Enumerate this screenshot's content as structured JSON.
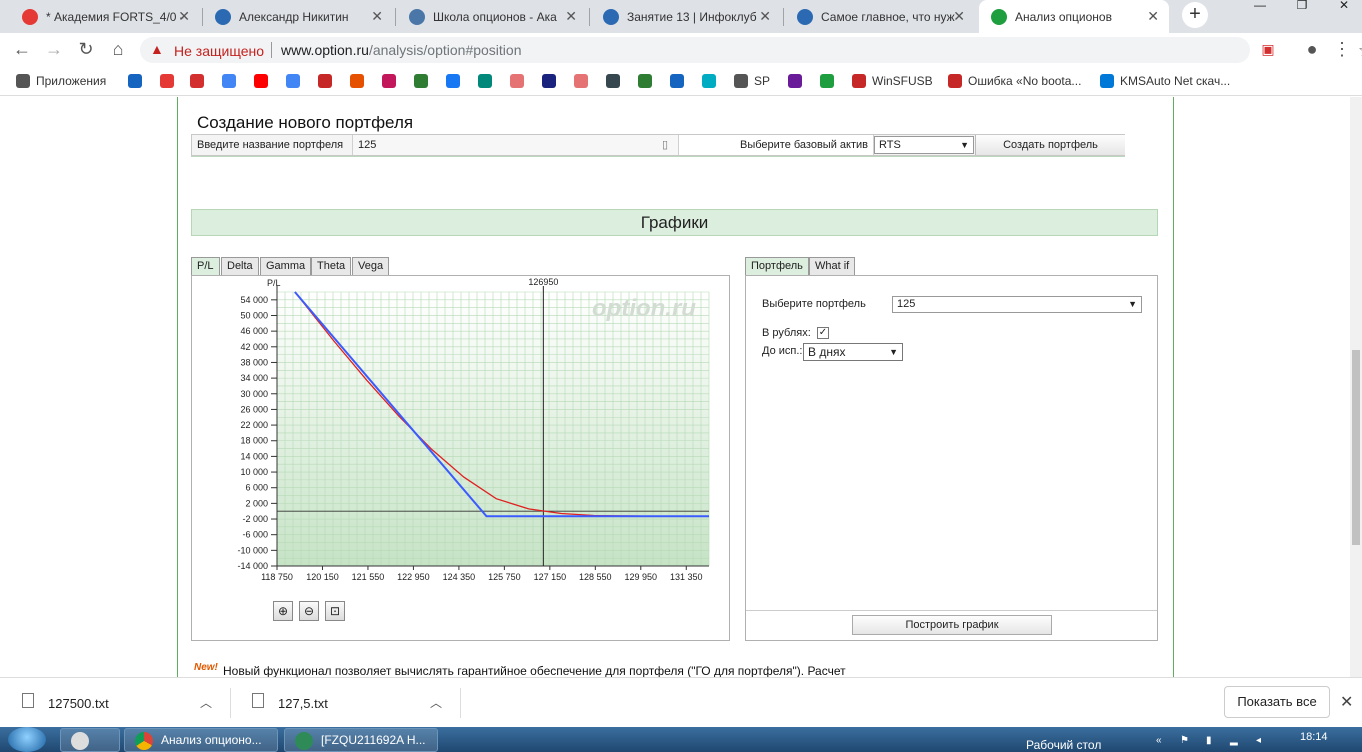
{
  "browser": {
    "tabs": [
      {
        "label": "* Академия FORTS_4/0 -",
        "active": false,
        "icon": "youtube-like-icon",
        "color": "#e53935"
      },
      {
        "label": "Александр Никитин",
        "active": false,
        "icon": "site-icon",
        "color": "#2b6ab3"
      },
      {
        "label": "Школа опционов - Ака",
        "active": false,
        "icon": "vk-icon",
        "color": "#4a76a8"
      },
      {
        "label": "Занятие 13 | Инфоклуб",
        "active": false,
        "icon": "site-icon",
        "color": "#2b6ab3"
      },
      {
        "label": "Самое главное, что нуж",
        "active": false,
        "icon": "site-icon",
        "color": "#2b6ab3"
      },
      {
        "label": "Анализ опционов",
        "active": true,
        "icon": "option-ru-icon",
        "color": "#1e9e3e"
      }
    ],
    "not_secure_label": "Не защищено",
    "url_host": "www.option.ru",
    "url_path": "/analysis/option#position",
    "bookmarks": [
      {
        "label": "Приложения",
        "icon": "apps-icon",
        "color": "#555"
      },
      {
        "label": "",
        "icon": "gear-icon",
        "color": "#1565c0"
      },
      {
        "label": "",
        "icon": "yandex-icon",
        "color": "#e53935"
      },
      {
        "label": "",
        "icon": "badge-220-icon",
        "color": "#d32f2f"
      },
      {
        "label": "",
        "icon": "google-icon",
        "color": "#4285f4"
      },
      {
        "label": "",
        "icon": "youtube-icon",
        "color": "#ff0000"
      },
      {
        "label": "",
        "icon": "translate-icon",
        "color": "#4285f4"
      },
      {
        "label": "",
        "icon": "r-icon",
        "color": "#c62828"
      },
      {
        "label": "",
        "icon": "tools-icon",
        "color": "#e65100"
      },
      {
        "label": "",
        "icon": "m-icon",
        "color": "#c2185b"
      },
      {
        "label": "",
        "icon": "w-icon",
        "color": "#2e7d32"
      },
      {
        "label": "",
        "icon": "facebook-icon",
        "color": "#1877f2"
      },
      {
        "label": "",
        "icon": "qs-icon",
        "color": "#00897b"
      },
      {
        "label": "",
        "icon": "heartbeat-icon",
        "color": "#e57373"
      },
      {
        "label": "",
        "icon": "dollar-icon",
        "color": "#1a237e"
      },
      {
        "label": "",
        "icon": "heartbeat-icon",
        "color": "#e57373"
      },
      {
        "label": "",
        "icon": "grid-icon",
        "color": "#37474f"
      },
      {
        "label": "",
        "icon": "chart-icon",
        "color": "#2e7d32"
      },
      {
        "label": "",
        "icon": "chart-icon",
        "color": "#1565c0"
      },
      {
        "label": "",
        "icon": "circle-icon",
        "color": "#00acc1"
      },
      {
        "label": "SP",
        "icon": "globe-icon",
        "color": "#555"
      },
      {
        "label": "",
        "icon": "e-icon",
        "color": "#6a1b9a"
      },
      {
        "label": "",
        "icon": "option-ru-icon",
        "color": "#1e9e3e"
      },
      {
        "label": "WinSFUSB",
        "icon": "r-icon",
        "color": "#c62828"
      },
      {
        "label": "Ошибка «No boota...",
        "icon": "r-icon",
        "color": "#c62828"
      },
      {
        "label": "KMSAuto Net скач...",
        "icon": "windows-icon",
        "color": "#0078d7"
      }
    ]
  },
  "page": {
    "new_portfolio_title": "Создание нового портфеля",
    "portfolio_name_label": "Введите название портфеля",
    "portfolio_name_value": "125",
    "base_asset_label": "Выберите базовый актив",
    "base_asset_value": "RTS",
    "create_button": "Создать портфель",
    "graphs_title": "Графики",
    "chart_tabs": [
      "P/L",
      "Delta",
      "Gamma",
      "Theta",
      "Vega"
    ],
    "settings_tabs": [
      "Портфель",
      "What if"
    ],
    "select_portfolio_label": "Выберите портфель",
    "select_portfolio_value": "125",
    "rub_label": "В рублях:",
    "rub_checked": true,
    "to_expiry_label": "До исп.:",
    "to_expiry_value": "В днях",
    "build_button": "Построить график",
    "news_new": "New!",
    "news_text": "Новый функционал позволяет вычислять гарантийное обеспечение для портфеля (\"ГО для портфеля\"). Расчет"
  },
  "chart_data": {
    "type": "line",
    "ylabel": "P/L",
    "watermark": "option.ru",
    "marker_label": "126950",
    "marker_x": 126950,
    "xlim": [
      118750,
      132050
    ],
    "ylim": [
      -14000,
      56000
    ],
    "x_ticks": [
      "118 750",
      "120 150",
      "121 550",
      "122 950",
      "124 350",
      "125 750",
      "127 150",
      "128 550",
      "129 950",
      "131 350"
    ],
    "y_ticks": [
      "54 000",
      "50 000",
      "46 000",
      "42 000",
      "38 000",
      "34 000",
      "30 000",
      "26 000",
      "22 000",
      "18 000",
      "14 000",
      "10 000",
      "6 000",
      "2 000",
      "-2 000",
      "-6 000",
      "-10 000",
      "-14 000"
    ],
    "series": [
      {
        "color": "#3b5bff",
        "x": [
          119300,
          125200,
          132050
        ],
        "y": [
          56000,
          -1300,
          -1300
        ]
      },
      {
        "color": "#e02020",
        "x": [
          119300,
          120500,
          121500,
          122500,
          123500,
          124500,
          125500,
          126500,
          127500,
          128500,
          130000,
          132050
        ],
        "y": [
          56000,
          43500,
          33600,
          24300,
          15900,
          8700,
          3200,
          600,
          -600,
          -1100,
          -1250,
          -1300
        ]
      }
    ],
    "colors": {
      "grid": "#b6d9b6",
      "bg_top": "#ffffff",
      "bg_bottom": "#c6e3c6"
    }
  },
  "downloads": {
    "items": [
      "127500.txt",
      "127,5.txt"
    ],
    "show_all": "Показать все"
  },
  "taskbar": {
    "tasks": [
      "Анализ опционо...",
      "[FZQU211692A Н..."
    ],
    "desktop_label": "Рабочий стол",
    "clock": "18:14"
  }
}
